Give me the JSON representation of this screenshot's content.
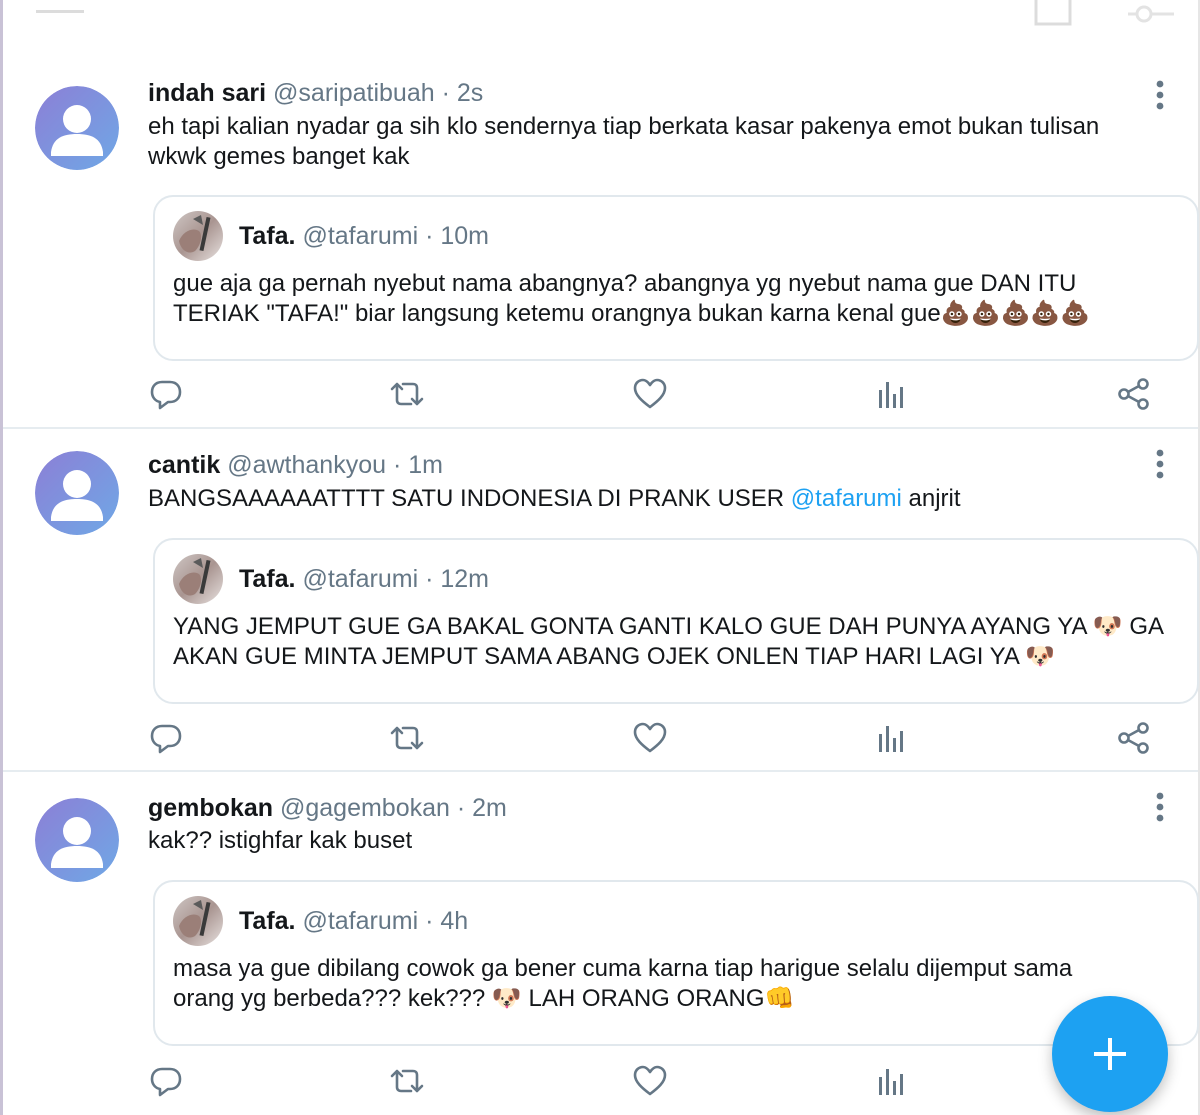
{
  "colors": {
    "accent": "#1da1f2",
    "secondary_text": "#657786",
    "avatar_gradient_start": "#8c7fd6",
    "avatar_gradient_end": "#6fa8e6",
    "icon_gray": "#657786"
  },
  "icons": {
    "top_menu": "menu-icon",
    "top_square": "square-icon",
    "top_key": "key-icon",
    "more": "more-vertical-icon",
    "reply": "reply-icon",
    "retweet": "retweet-icon",
    "like": "heart-icon",
    "stats": "stats-icon",
    "share": "share-icon",
    "compose": "plus-icon"
  },
  "tweets": [
    {
      "name": "indah sari",
      "handle": "@saripatibuah",
      "separator": "·",
      "time": "2s",
      "text_line1": "eh tapi kalian nyadar ga sih klo sendernya tiap berkata kasar pakenya emot bukan tulisan",
      "text_line2": "wkwk gemes banget kak",
      "quote": {
        "name": "Tafa.",
        "handle": "@tafarumi",
        "separator": "·",
        "time": "10m",
        "text_line1": "gue aja ga pernah nyebut nama abangnya? abangnya yg nyebut nama gue DAN ITU",
        "text_line2": "TERIAK \"TAFA!\" biar langsung ketemu orangnya bukan karna kenal gue💩💩💩💩💩"
      }
    },
    {
      "name": "cantik",
      "handle": "@awthankyou",
      "separator": "·",
      "time": "1m",
      "text_prefix": "BANGSAAAAAATTTT SATU INDONESIA DI PRANK USER ",
      "text_mention": "@tafarumi",
      "text_suffix": " anjrit",
      "quote": {
        "name": "Tafa.",
        "handle": "@tafarumi",
        "separator": "·",
        "time": "12m",
        "text_line1": "YANG JEMPUT GUE GA BAKAL GONTA GANTI KALO GUE DAH PUNYA AYANG YA 🐶 GA",
        "text_line2": "AKAN GUE MINTA JEMPUT SAMA ABANG OJEK ONLEN TIAP HARI LAGI YA 🐶"
      }
    },
    {
      "name": "gembokan",
      "handle": "@gagembokan",
      "separator": "·",
      "time": "2m",
      "text_line1": "kak?? istighfar kak buset",
      "quote": {
        "name": "Tafa.",
        "handle": "@tafarumi",
        "separator": "·",
        "time": "4h",
        "text_line1": "masa ya gue dibilang cowok ga bener cuma karna tiap harigue selalu dijemput sama",
        "text_line2": "orang yg berbeda??? kek??? 🐶 LAH ORANG ORANG👊"
      }
    }
  ]
}
